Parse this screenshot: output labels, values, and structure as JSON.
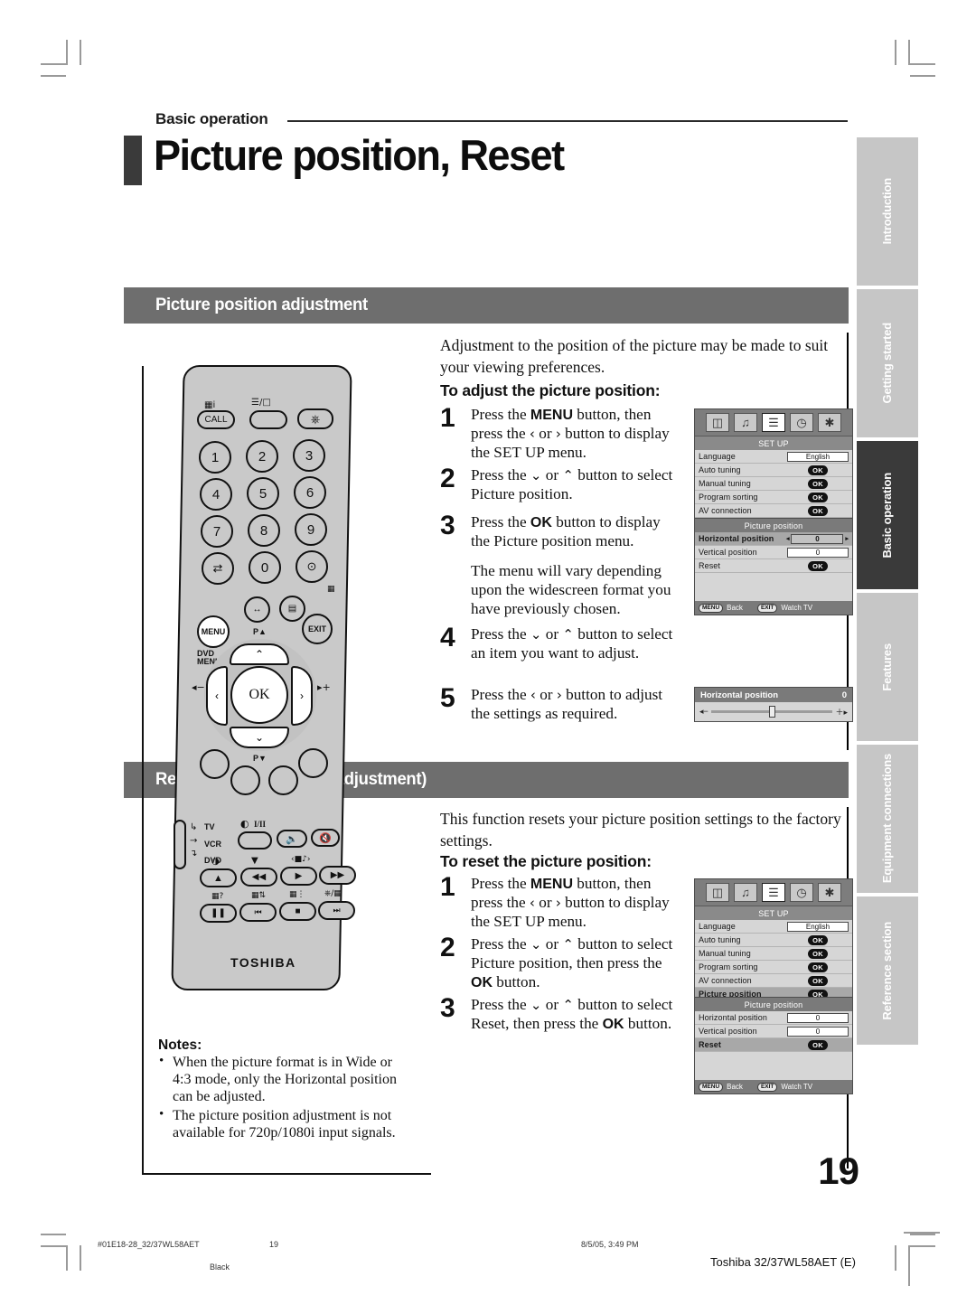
{
  "header": {
    "kicker": "Basic operation",
    "title": "Picture position, Reset"
  },
  "sections": [
    {
      "bar": "Picture position adjustment",
      "intro": "Adjustment to the position of the picture may be made to suit your viewing preferences.",
      "subhead": "To adjust the picture position:",
      "steps": [
        {
          "num": "1",
          "text": "Press the MENU button, then press the ‹ or › button to display the SET UP menu."
        },
        {
          "num": "2",
          "text": "Press the ⌄ or ⌃ button to select Picture position."
        },
        {
          "num": "3",
          "text": "Press the OK button to display the Picture position menu."
        },
        {
          "num": "",
          "text": "The menu will vary depending upon the widescreen format you have previously chosen."
        },
        {
          "num": "4",
          "text": "Press the ⌄ or ⌃ button to select an item you want to adjust."
        },
        {
          "num": "5",
          "text": "Press the ‹ or › button to adjust the settings as required."
        }
      ]
    },
    {
      "bar": "Reset (Picture position adjustment)",
      "intro": "This function resets your picture position settings to the factory settings.",
      "subhead": "To reset the picture position:",
      "steps": [
        {
          "num": "1",
          "text": "Press the MENU button, then press the ‹ or › button to display the SET UP menu."
        },
        {
          "num": "2",
          "text": "Press the ⌄ or ⌃ button to select Picture position, then press the OK button."
        },
        {
          "num": "3",
          "text": "Press the ⌄ or ⌃ button to select Reset, then press the OK button."
        }
      ]
    }
  ],
  "osd": {
    "setup": {
      "title": "SET UP",
      "icons": [
        "picture-icon",
        "sound-icon",
        "setup-icon",
        "timer-icon",
        "tools-icon"
      ],
      "selected_icon_index": 2,
      "rows": [
        {
          "label": "Language",
          "value": "English",
          "type": "value"
        },
        {
          "label": "Auto tuning",
          "value": "OK",
          "type": "ok"
        },
        {
          "label": "Manual tuning",
          "value": "OK",
          "type": "ok"
        },
        {
          "label": "Program sorting",
          "value": "OK",
          "type": "ok"
        },
        {
          "label": "AV connection",
          "value": "OK",
          "type": "ok"
        },
        {
          "label": "Picture position",
          "value": "OK",
          "type": "ok",
          "highlight": true
        }
      ],
      "footer": {
        "menu_key": "MENU",
        "menu_action": "Back",
        "exit_key": "EXIT",
        "exit_action": "Watch TV"
      }
    },
    "picture_position_a": {
      "title": "Picture position",
      "rows": [
        {
          "label": "Horizontal position",
          "value": "0",
          "type": "value",
          "highlight": true,
          "arrows": true
        },
        {
          "label": "Vertical position",
          "value": "0",
          "type": "value"
        },
        {
          "label": "Reset",
          "value": "OK",
          "type": "ok"
        }
      ],
      "footer": {
        "menu_key": "MENU",
        "menu_action": "Back",
        "exit_key": "EXIT",
        "exit_action": "Watch TV"
      }
    },
    "picture_position_b": {
      "title": "Picture position",
      "rows": [
        {
          "label": "Horizontal position",
          "value": "0",
          "type": "value"
        },
        {
          "label": "Vertical position",
          "value": "0",
          "type": "value"
        },
        {
          "label": "Reset",
          "value": "OK",
          "type": "ok",
          "highlight": true
        }
      ],
      "footer": {
        "menu_key": "MENU",
        "menu_action": "Back",
        "exit_key": "EXIT",
        "exit_action": "Watch TV"
      }
    },
    "slider": {
      "label": "Horizontal position",
      "value": "0",
      "minus": "◂−",
      "plus": "＋▸"
    }
  },
  "remote": {
    "brand": "TOSHIBA",
    "keys": {
      "call": "CALL",
      "menu": "MENU",
      "exit": "EXIT",
      "ok": "OK",
      "dvd_menu_line1": "DVD",
      "dvd_menu_line2": "MENU",
      "p_up": "P▲",
      "p_down": "P▼",
      "numbers": [
        "1",
        "2",
        "3",
        "4",
        "5",
        "6",
        "7",
        "8",
        "9",
        "0"
      ],
      "mode_tv": "TV",
      "mode_vcr": "VCR",
      "mode_dvd": "DVD",
      "stereo": "I/II"
    }
  },
  "notes": {
    "title": "Notes:",
    "items": [
      "When the picture format is in Wide or 4:3 mode, only the Horizontal position can be adjusted.",
      "The picture position adjustment is not available for 720p/1080i input signals."
    ]
  },
  "tabs": [
    {
      "label": "Introduction",
      "active": false
    },
    {
      "label": "Getting started",
      "active": false
    },
    {
      "label": "Basic operation",
      "active": true
    },
    {
      "label": "Features",
      "active": false
    },
    {
      "label": "Equipment connections",
      "active": false
    },
    {
      "label": "Reference section",
      "active": false
    }
  ],
  "page_number": "19",
  "footer": {
    "file": "#01E18-28_32/37WL58AET",
    "page": "19",
    "color": "Black",
    "timestamp": "8/5/05, 3:49 PM",
    "model": "Toshiba 32/37WL58AET (E)"
  }
}
